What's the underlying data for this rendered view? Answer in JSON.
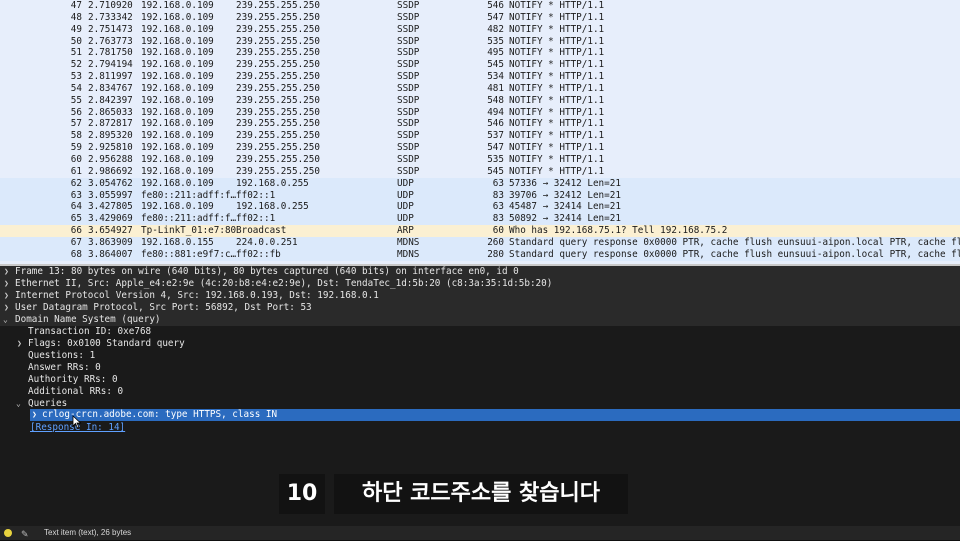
{
  "packets": [
    {
      "no": "47",
      "time": "2.710920",
      "src": "192.168.0.109",
      "dst": "239.255.255.250",
      "proto": "SSDP",
      "len": "546",
      "info": "NOTIFY * HTTP/1.1",
      "cls": "ssdp"
    },
    {
      "no": "48",
      "time": "2.733342",
      "src": "192.168.0.109",
      "dst": "239.255.255.250",
      "proto": "SSDP",
      "len": "547",
      "info": "NOTIFY * HTTP/1.1",
      "cls": "ssdp"
    },
    {
      "no": "49",
      "time": "2.751473",
      "src": "192.168.0.109",
      "dst": "239.255.255.250",
      "proto": "SSDP",
      "len": "482",
      "info": "NOTIFY * HTTP/1.1",
      "cls": "ssdp"
    },
    {
      "no": "50",
      "time": "2.763773",
      "src": "192.168.0.109",
      "dst": "239.255.255.250",
      "proto": "SSDP",
      "len": "535",
      "info": "NOTIFY * HTTP/1.1",
      "cls": "ssdp"
    },
    {
      "no": "51",
      "time": "2.781750",
      "src": "192.168.0.109",
      "dst": "239.255.255.250",
      "proto": "SSDP",
      "len": "495",
      "info": "NOTIFY * HTTP/1.1",
      "cls": "ssdp"
    },
    {
      "no": "52",
      "time": "2.794194",
      "src": "192.168.0.109",
      "dst": "239.255.255.250",
      "proto": "SSDP",
      "len": "545",
      "info": "NOTIFY * HTTP/1.1",
      "cls": "ssdp"
    },
    {
      "no": "53",
      "time": "2.811997",
      "src": "192.168.0.109",
      "dst": "239.255.255.250",
      "proto": "SSDP",
      "len": "534",
      "info": "NOTIFY * HTTP/1.1",
      "cls": "ssdp"
    },
    {
      "no": "54",
      "time": "2.834767",
      "src": "192.168.0.109",
      "dst": "239.255.255.250",
      "proto": "SSDP",
      "len": "481",
      "info": "NOTIFY * HTTP/1.1",
      "cls": "ssdp"
    },
    {
      "no": "55",
      "time": "2.842397",
      "src": "192.168.0.109",
      "dst": "239.255.255.250",
      "proto": "SSDP",
      "len": "548",
      "info": "NOTIFY * HTTP/1.1",
      "cls": "ssdp"
    },
    {
      "no": "56",
      "time": "2.865033",
      "src": "192.168.0.109",
      "dst": "239.255.255.250",
      "proto": "SSDP",
      "len": "494",
      "info": "NOTIFY * HTTP/1.1",
      "cls": "ssdp"
    },
    {
      "no": "57",
      "time": "2.872817",
      "src": "192.168.0.109",
      "dst": "239.255.255.250",
      "proto": "SSDP",
      "len": "546",
      "info": "NOTIFY * HTTP/1.1",
      "cls": "ssdp"
    },
    {
      "no": "58",
      "time": "2.895320",
      "src": "192.168.0.109",
      "dst": "239.255.255.250",
      "proto": "SSDP",
      "len": "537",
      "info": "NOTIFY * HTTP/1.1",
      "cls": "ssdp"
    },
    {
      "no": "59",
      "time": "2.925810",
      "src": "192.168.0.109",
      "dst": "239.255.255.250",
      "proto": "SSDP",
      "len": "547",
      "info": "NOTIFY * HTTP/1.1",
      "cls": "ssdp"
    },
    {
      "no": "60",
      "time": "2.956288",
      "src": "192.168.0.109",
      "dst": "239.255.255.250",
      "proto": "SSDP",
      "len": "535",
      "info": "NOTIFY * HTTP/1.1",
      "cls": "ssdp"
    },
    {
      "no": "61",
      "time": "2.986692",
      "src": "192.168.0.109",
      "dst": "239.255.255.250",
      "proto": "SSDP",
      "len": "545",
      "info": "NOTIFY * HTTP/1.1",
      "cls": "ssdp"
    },
    {
      "no": "62",
      "time": "3.054762",
      "src": "192.168.0.109",
      "dst": "192.168.0.255",
      "proto": "UDP",
      "len": "63",
      "info": "57336 → 32412 Len=21",
      "cls": "udp"
    },
    {
      "no": "63",
      "time": "3.055997",
      "src": "fe80::211:adff:f…",
      "dst": "ff02::1",
      "proto": "UDP",
      "len": "83",
      "info": "39706 → 32412 Len=21",
      "cls": "udp"
    },
    {
      "no": "64",
      "time": "3.427805",
      "src": "192.168.0.109",
      "dst": "192.168.0.255",
      "proto": "UDP",
      "len": "63",
      "info": "45487 → 32414 Len=21",
      "cls": "udp"
    },
    {
      "no": "65",
      "time": "3.429069",
      "src": "fe80::211:adff:f…",
      "dst": "ff02::1",
      "proto": "UDP",
      "len": "83",
      "info": "50892 → 32414 Len=21",
      "cls": "udp"
    },
    {
      "no": "66",
      "time": "3.654927",
      "src": "Tp-LinkT_01:e7:80",
      "dst": "Broadcast",
      "proto": "ARP",
      "len": "60",
      "info": "Who has 192.168.75.1? Tell 192.168.75.2",
      "cls": "arp"
    },
    {
      "no": "67",
      "time": "3.863909",
      "src": "192.168.0.155",
      "dst": "224.0.0.251",
      "proto": "MDNS",
      "len": "260",
      "info": "Standard query response 0x0000 PTR, cache flush eunsuui-aipon.local PTR, cache flush eun",
      "cls": "mdns"
    },
    {
      "no": "68",
      "time": "3.864007",
      "src": "fe80::881:e9f7:c…",
      "dst": "ff02::fb",
      "proto": "MDNS",
      "len": "280",
      "info": "Standard query response 0x0000 PTR, cache flush eunsuui-aipon.local PTR, cache flush eun",
      "cls": "mdns"
    }
  ],
  "details": {
    "frame": "Frame 13: 80 bytes on wire (640 bits), 80 bytes captured (640 bits) on interface en0, id 0",
    "ethernet": "Ethernet II, Src: Apple_e4:e2:9e (4c:20:b8:e4:e2:9e), Dst: TendaTec_1d:5b:20 (c8:3a:35:1d:5b:20)",
    "ip": "Internet Protocol Version 4, Src: 192.168.0.193, Dst: 192.168.0.1",
    "udp": "User Datagram Protocol, Src Port: 56892, Dst Port: 53",
    "dns": "Domain Name System (query)",
    "transaction_id": "Transaction ID: 0xe768",
    "flags": "Flags: 0x0100 Standard query",
    "questions": "Questions: 1",
    "answer_rrs": "Answer RRs: 0",
    "authority_rrs": "Authority RRs: 0",
    "additional_rrs": "Additional RRs: 0",
    "queries": "Queries",
    "query_item": "crlog-crcn.adobe.com: type HTTPS, class IN",
    "response_in": "[Response In: 14]"
  },
  "subtitle": {
    "step": "10",
    "text": "하단 코드주소를 찾습니다"
  },
  "status": {
    "text": "Text item (text), 26 bytes"
  },
  "colors": {
    "ssdp_row": "#e7eefb",
    "arp_row": "#fbf0d2",
    "selected": "#2b6bbf",
    "status_led": "#e8d33f"
  }
}
